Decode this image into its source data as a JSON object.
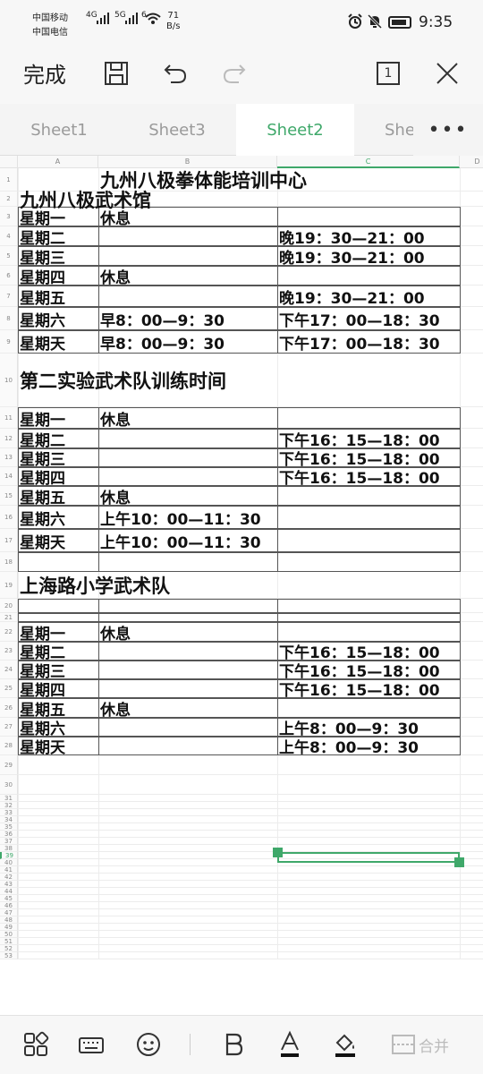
{
  "status_bar": {
    "carrier1": "中国移动",
    "carrier2": "中国电信",
    "sig1": "4G",
    "sig2": "5G",
    "sig3": "6",
    "speed": "71",
    "speed_unit": "B/s",
    "time": "9:35"
  },
  "toolbar": {
    "done_label": "完成",
    "page_label": "1"
  },
  "tabs": [
    "Sheet1",
    "Sheet3",
    "Sheet2",
    "She"
  ],
  "active_tab": "Sheet2",
  "more_label": "•••",
  "columns": [
    "A",
    "B",
    "C",
    "D"
  ],
  "rows": [
    "1",
    "2",
    "3",
    "4",
    "5",
    "6",
    "7",
    "8",
    "9",
    "10",
    "11",
    "12",
    "13",
    "14",
    "15",
    "16",
    "17",
    "18",
    "19",
    "20",
    "21",
    "22",
    "23",
    "24",
    "25",
    "26",
    "27",
    "28",
    "29",
    "30",
    "31",
    "32",
    "33",
    "34",
    "35",
    "36",
    "37",
    "38",
    "39",
    "40",
    "41",
    "42",
    "43",
    "44",
    "45",
    "46",
    "47",
    "48",
    "49",
    "50",
    "51",
    "52",
    "53"
  ],
  "sheet": {
    "r1": {
      "b": "九州八极拳体能培训中心"
    },
    "r2": {
      "a": "九州八极武术馆"
    },
    "r3": {
      "a": "星期一",
      "b": "休息"
    },
    "r4": {
      "a": "星期二",
      "c": "晚19：30—21：00"
    },
    "r5": {
      "a": "星期三",
      "c": "晚19：30—21：00"
    },
    "r6": {
      "a": "星期四",
      "b": "休息"
    },
    "r7": {
      "a": "星期五",
      "c": "晚19：30—21：00"
    },
    "r8": {
      "a": "星期六",
      "b": "早8：00—9：30",
      "c": "下午17：00—18：30"
    },
    "r9": {
      "a": "星期天",
      "b": "早8：00—9：30",
      "c": "下午17：00—18：30"
    },
    "r10": {
      "a": "第二实验武术队训练时间"
    },
    "r11": {
      "a": "星期一",
      "b": "休息"
    },
    "r12": {
      "a": "星期二",
      "c": "下午16：15—18：00"
    },
    "r13": {
      "a": "星期三",
      "c": "下午16：15—18：00"
    },
    "r14": {
      "a": "星期四",
      "c": "下午16：15—18：00"
    },
    "r15": {
      "a": "星期五",
      "b": "休息"
    },
    "r16": {
      "a": "星期六",
      "b": "上午10：00—11：30"
    },
    "r17": {
      "a": "星期天",
      "b": "上午10：00—11：30"
    },
    "r19": {
      "a": "上海路小学武术队"
    },
    "r22": {
      "a": "星期一",
      "b": "休息"
    },
    "r23": {
      "a": "星期二",
      "c": "下午16：15—18：00"
    },
    "r24": {
      "a": "星期三",
      "c": "下午16：15—18：00"
    },
    "r25": {
      "a": "星期四",
      "c": "下午16：15—18：00"
    },
    "r26": {
      "a": "星期五",
      "b": "休息"
    },
    "r27": {
      "a": "星期六",
      "c": "上午8：00—9：30"
    },
    "r28": {
      "a": "星期天",
      "c": "上午8：00—9：30"
    }
  },
  "bottom_toolbar": {
    "merge_label": "合并"
  },
  "colors": {
    "accent": "#3fa86a"
  }
}
